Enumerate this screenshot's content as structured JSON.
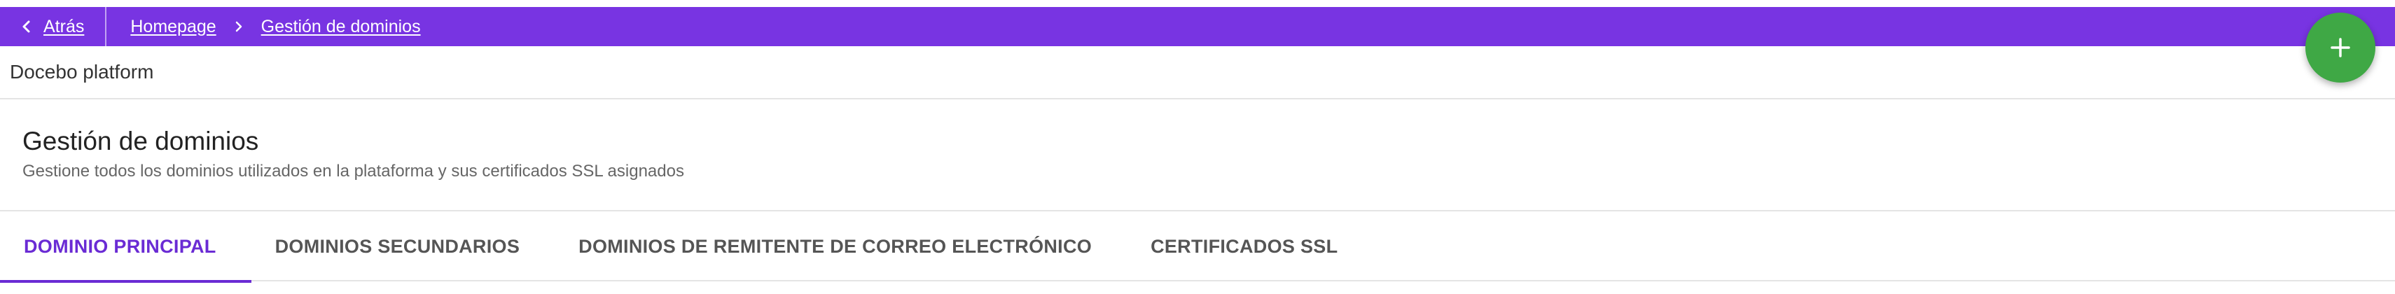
{
  "breadcrumb": {
    "back_label": "Atrás",
    "items": [
      "Homepage",
      "Gestión de dominios"
    ]
  },
  "platform": {
    "name": "Docebo platform"
  },
  "page": {
    "title": "Gestión de dominios",
    "subtitle": "Gestione todos los dominios utilizados en la plataforma y sus certificados SSL asignados"
  },
  "tabs": [
    {
      "label": "DOMINIO PRINCIPAL",
      "active": true
    },
    {
      "label": "DOMINIOS SECUNDARIOS",
      "active": false
    },
    {
      "label": "DOMINIOS DE REMITENTE DE CORREO ELECTRÓNICO",
      "active": false
    },
    {
      "label": "CERTIFICADOS SSL",
      "active": false
    }
  ],
  "fab": {
    "icon": "plus-icon"
  },
  "colors": {
    "topbar": "#7834e2",
    "accent": "#6a2bd4",
    "fab": "#3fa845"
  }
}
